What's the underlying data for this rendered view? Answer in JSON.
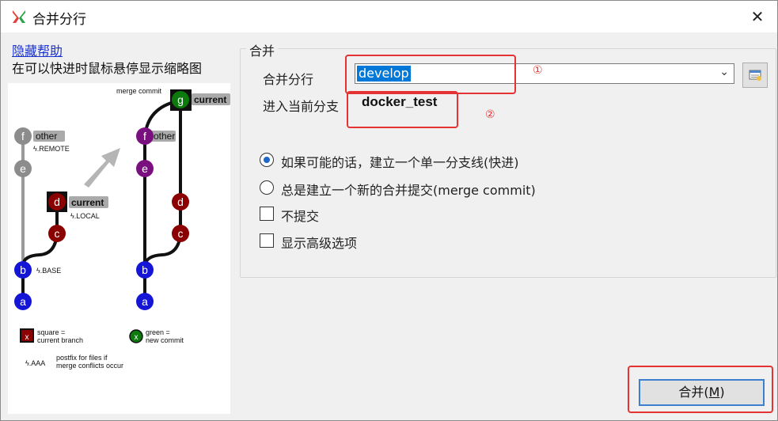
{
  "window": {
    "title": "合并分行",
    "close_glyph": "✕"
  },
  "left": {
    "help_link": "隐藏帮助",
    "hint": "在可以快进时鼠标悬停显示缩略图",
    "diagram": {
      "merge_commit_label": "merge commit",
      "before": {
        "nodes": [
          "f",
          "e",
          "d",
          "c",
          "b",
          "a"
        ],
        "tag_other": "other",
        "tag_remote": "ϟ.REMOTE",
        "tag_current": "current",
        "tag_local": "ϟ.LOCAL",
        "tag_base": "ϟ.BASE"
      },
      "after": {
        "nodes": [
          "g",
          "f",
          "e",
          "d",
          "c",
          "b",
          "a"
        ],
        "tag_current": "current",
        "tag_other": "other"
      },
      "legend": {
        "square_mark": "x",
        "square_text1": "square =",
        "square_text2": "current branch",
        "green_mark": "x",
        "green_text1": "green =",
        "green_text2": "new commit",
        "postfix_mark": "ϟ.AAA",
        "postfix_text1": "postfix for files if",
        "postfix_text2": "merge conflicts occur"
      }
    }
  },
  "merge_group": {
    "title": "合并",
    "from_label": "合并分行",
    "from_value": "develop",
    "into_label": "进入当前分支",
    "into_value": "docker_test",
    "annot_1": "①",
    "annot_2": "②",
    "options": [
      {
        "type": "radio",
        "checked": true,
        "label": "如果可能的话，建立一个单一分支线(快进)"
      },
      {
        "type": "radio",
        "checked": false,
        "label": "总是建立一个新的合并提交(merge commit)"
      },
      {
        "type": "checkbox",
        "checked": false,
        "label": "不提交"
      },
      {
        "type": "checkbox",
        "checked": false,
        "label": "显示高级选项"
      }
    ]
  },
  "footer": {
    "merge_button": "合并(M)",
    "merge_button_pre": "合并(",
    "merge_button_key": "M",
    "merge_button_post": ")"
  },
  "colors": {
    "accent": "#0078d7",
    "annotation": "#e53333",
    "node_blue": "#1515d6",
    "node_red": "#8b0000",
    "node_purple": "#7a1080",
    "node_gray": "#8c8c8c",
    "node_green": "#0c7a0c"
  }
}
